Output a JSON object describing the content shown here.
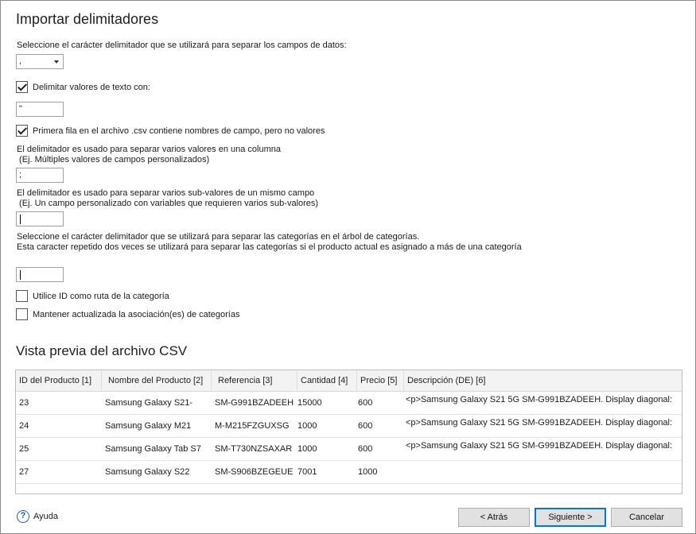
{
  "section_delimiters": {
    "title": "Importar delimitadores",
    "field_delimiter_label": "Seleccione el carácter delimitador que se utilizará para separar los campos de datos:",
    "field_delimiter_value": ",",
    "delimit_text": {
      "label": "Delimitar valores de texto con:",
      "checked": true,
      "value": "\""
    },
    "first_row": {
      "label": "Primera fila en el archivo .csv contiene nombres de campo, pero no valores",
      "checked": true
    },
    "multi_values": {
      "line1": "El delimitador es usado para separar varios valores en una columna",
      "line2": " (Ej. Múltiples valores de campos personalizados)",
      "value": ";"
    },
    "sub_values": {
      "line1": "El delimitador es usado para separar varios sub-valores de un mismo campo",
      "line2": " (Ej. Un campo personalizado con variables que requieren varios sub-valores)",
      "value": ""
    },
    "category": {
      "line1": "Seleccione el carácter delimitador que se utilizará para separar las categorías en el árbol de categorías.",
      "line2": "Esta caracter repetido dos veces se utilizará para separar las categorías si el producto actual es asignado a más de una categoría",
      "value": ""
    },
    "use_id_path": {
      "label": "Utilice ID como ruta de la categoría",
      "checked": false
    },
    "keep_updated": {
      "label": "Mantener actualizada la asociación(es) de categorías",
      "checked": false
    }
  },
  "preview": {
    "title": "Vista previa del archivo CSV",
    "columns": [
      "ID del Producto [1]",
      "Nombre del Producto [2]",
      "Referencia [3]",
      "Cantidad [4]",
      "Precio [5]",
      "Descripción (DE) [6]"
    ],
    "rows": [
      [
        "23",
        "Samsung Galaxy S21-",
        "SM-G991BZADEEH",
        "15000",
        "600",
        "<p>Samsung Galaxy S21 5G SM-G991BZADEEH. Display diagonal:"
      ],
      [
        "24",
        "Samsung Galaxy M21",
        "M-M215FZGUXSG",
        "1000",
        "600",
        "<p>Samsung Galaxy S21 5G SM-G991BZADEEH. Display diagonal:"
      ],
      [
        "25",
        "Samsung Galaxy Tab S7",
        "SM-T730NZSAXAR",
        "1000",
        "600",
        "<p>Samsung Galaxy S21 5G SM-G991BZADEEH. Display diagonal:"
      ],
      [
        "27",
        "Samsung Galaxy S22",
        "SM-S906BZEGEUE",
        "7001",
        "1000",
        ""
      ]
    ]
  },
  "footer": {
    "help": "Ayuda",
    "help_icon": "?",
    "back": "< Atrás",
    "next": "Siguiente >",
    "cancel": "Cancelar"
  }
}
